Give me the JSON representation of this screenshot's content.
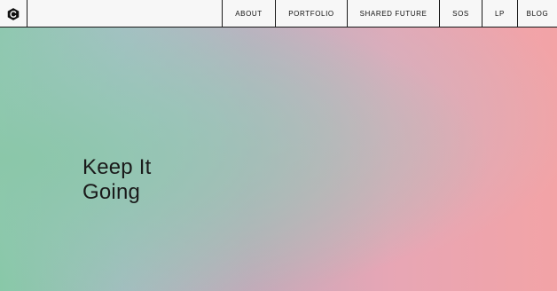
{
  "header": {
    "logo_icon": "hexagon-c-logo-icon",
    "nav": [
      {
        "label": "ABOUT"
      },
      {
        "label": "PORTFOLIO"
      },
      {
        "label": "SHARED FUTURE"
      },
      {
        "label": "SOS"
      },
      {
        "label": "LP"
      },
      {
        "label": "BLOG"
      }
    ]
  },
  "hero": {
    "title_lines": [
      "Keep It",
      "Going"
    ],
    "gradient_colors": [
      "#88c9a8",
      "#a7bcc3",
      "#c6a9bb",
      "#e7a6b5",
      "#f3a3a6"
    ]
  },
  "colors": {
    "header_bg": "#f7f7f7",
    "header_border": "#1b1b1b",
    "text": "#111111"
  }
}
